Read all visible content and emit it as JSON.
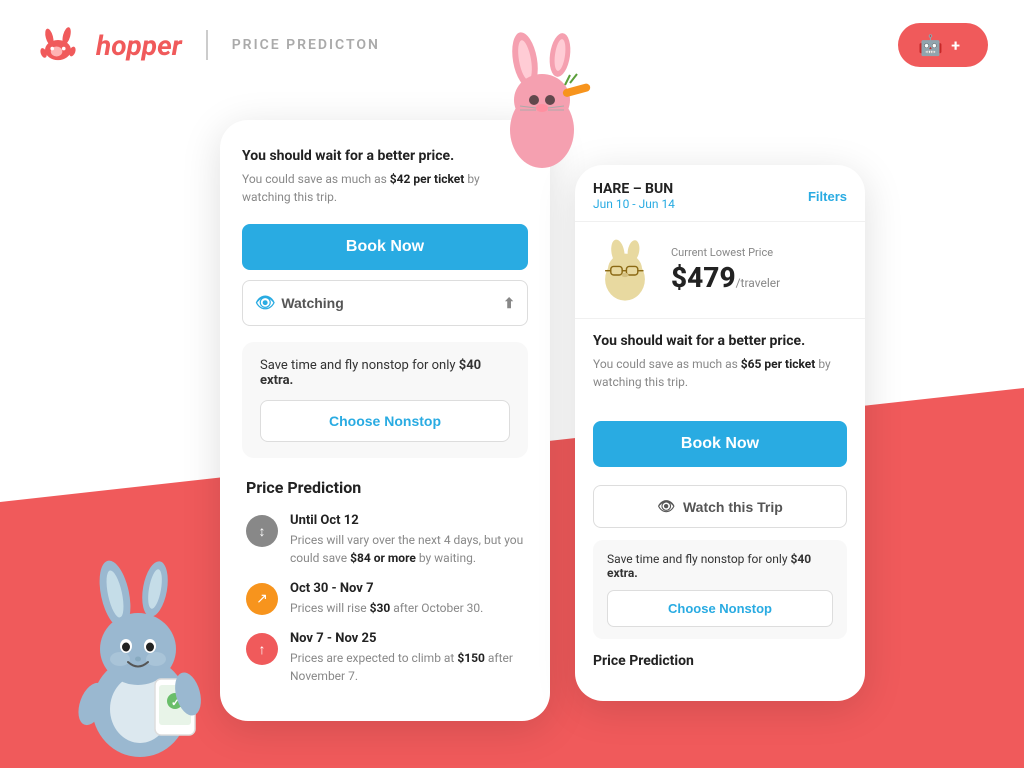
{
  "header": {
    "logo_text": "hopper",
    "divider": "|",
    "page_title": "PRICE PREDICTON",
    "app_badge": {
      "android_icon": "🤖",
      "plus": "+",
      "apple_icon": ""
    }
  },
  "left_card": {
    "title": "You should wait for a better price.",
    "subtitle_prefix": "You could save as much as ",
    "savings": "$42 per ticket",
    "subtitle_suffix": " by watching this trip.",
    "book_now": "Book Now",
    "watching": "Watching",
    "nonstop_section": {
      "title_prefix": "Save time and fly nonstop for only ",
      "extra": "$40 extra.",
      "button": "Choose Nonstop"
    },
    "price_prediction": {
      "section_title": "Price Prediction",
      "items": [
        {
          "icon_type": "gray",
          "icon": "↕",
          "date_range": "Until Oct 12",
          "desc_prefix": "Prices will vary over the next 4 days, but you could save ",
          "highlight": "$84 or more",
          "desc_suffix": " by waiting."
        },
        {
          "icon_type": "orange",
          "icon": "↗",
          "date_range": "Oct 30 - Nov 7",
          "desc_prefix": "Prices will rise ",
          "highlight": "$30",
          "desc_suffix": " after October 30."
        },
        {
          "icon_type": "red",
          "icon": "↑",
          "date_range": "Nov 7 - Nov 25",
          "desc_prefix": "Prices are expected to climb at ",
          "highlight": "$150",
          "desc_suffix": " after November 7."
        }
      ]
    }
  },
  "right_card": {
    "route": "HARE – BUN",
    "dates": "Jun 10 - Jun 14",
    "filters": "Filters",
    "price_label": "Current Lowest Price",
    "price": "$479",
    "price_unit": "/traveler",
    "title": "You should wait for a better price.",
    "subtitle_prefix": "You could save as much as ",
    "savings": "$65 per ticket",
    "subtitle_suffix": " by watching this trip.",
    "book_now": "Book Now",
    "watch_trip": "Watch this Trip",
    "nonstop_section": {
      "title_prefix": "Save time and fly nonstop for only ",
      "extra": "$40 extra.",
      "button": "Choose Nonstop"
    },
    "price_prediction_title": "Price Prediction"
  }
}
